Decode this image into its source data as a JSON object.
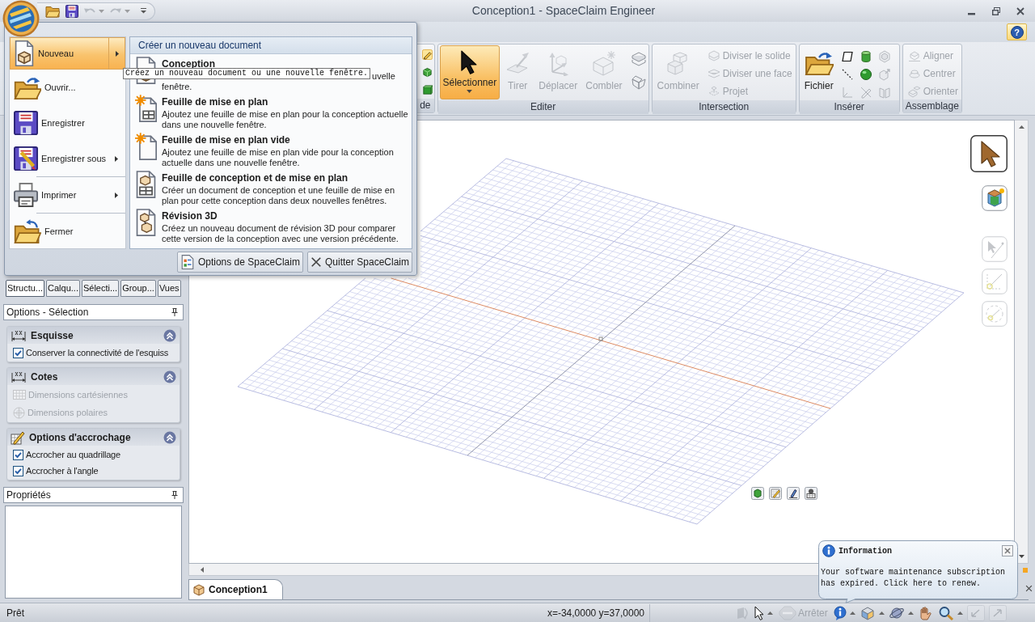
{
  "window": {
    "title": "Conception1 - SpaceClaim Engineer"
  },
  "quick_access": [
    {
      "disabled": false
    },
    {
      "disabled": false
    },
    {
      "disabled": true,
      "dropdown": true
    },
    {
      "disabled": true,
      "dropdown": true
    }
  ],
  "help_button": {
    "label": "?"
  },
  "ribbon": {
    "groups": [
      {
        "label": "de",
        "small_tools": [
          {
            "selected": true
          },
          {
            "selected": false
          },
          {
            "selected": false
          }
        ]
      },
      {
        "label": "Editer",
        "large_tools": [
          {
            "label": "Sélectionner",
            "selected": true,
            "dropdown": true,
            "disabled": false
          },
          {
            "label": "Tirer",
            "selected": false,
            "disabled": true
          },
          {
            "label": "Déplacer",
            "selected": false,
            "disabled": true
          },
          {
            "label": "Combler",
            "selected": false,
            "disabled": true
          }
        ],
        "small_tools": [
          {
            "disabled": false
          },
          {
            "disabled": false
          }
        ]
      },
      {
        "label": "Intersection",
        "large_tools": [
          {
            "label": "Combiner",
            "disabled": true
          }
        ],
        "small_tools": [
          {
            "label": "Diviser le solide",
            "disabled": true
          },
          {
            "label": "Diviser une face",
            "disabled": true
          },
          {
            "label": "Projet",
            "disabled": true
          }
        ]
      },
      {
        "label": "Insérer",
        "large_tools": [
          {
            "label": "Fichier",
            "disabled": false
          }
        ],
        "small_tools": [
          {
            "disabled": false
          },
          {
            "disabled": false
          },
          {
            "disabled": true
          },
          {
            "disabled": false
          },
          {
            "disabled": false
          },
          {
            "disabled": true
          },
          {
            "disabled": true
          },
          {
            "disabled": true
          },
          {
            "disabled": true
          }
        ]
      },
      {
        "label": "Assemblage",
        "small_tools": [
          {
            "label": "Aligner",
            "disabled": true
          },
          {
            "label": "Centrer",
            "disabled": true
          },
          {
            "label": "Orienter",
            "disabled": true
          }
        ]
      }
    ]
  },
  "app_menu": {
    "item_groups": [
      [
        {
          "label": "Nouveau",
          "selected": true,
          "submenu": true
        },
        {
          "label": "Ouvrir...",
          "selected": false,
          "submenu": false
        },
        {
          "label": "Enregistrer",
          "selected": false,
          "submenu": false
        },
        {
          "label": "Enregistrer sous",
          "selected": false,
          "submenu": true
        }
      ],
      [
        {
          "label": "Imprimer",
          "selected": false,
          "submenu": true
        }
      ],
      [
        {
          "label": "Fermer",
          "selected": false,
          "submenu": false
        }
      ]
    ],
    "submenu": {
      "title": "Créer un nouveau document",
      "items": [
        {
          "title": "Conception",
          "description_parts": [
            "uvelle",
            "fenêtre."
          ]
        },
        {
          "title": "Feuille de mise en plan",
          "description": "Ajoutez une feuille de mise en plan pour la conception actuelle dans une nouvelle fenêtre."
        },
        {
          "title": "Feuille de mise en plan vide",
          "description": "Ajoutez une feuille de mise en plan vide pour la conception actuelle dans une nouvelle fenêtre."
        },
        {
          "title": "Feuille de conception et de mise en plan",
          "description": "Créer un document de conception et une feuille de mise en plan pour cette conception dans deux nouvelles fenêtres."
        },
        {
          "title": "Révision 3D",
          "description": "Créez un nouveau document de révision 3D pour comparer cette version de la conception avec une version précédente."
        }
      ]
    },
    "tooltip": "Créez un nouveau document ou une nouvelle fenêtre.",
    "buttons": [
      {
        "label": "Options de SpaceClaim"
      },
      {
        "label": "Quitter SpaceClaim"
      }
    ]
  },
  "panel_tabs": [
    {
      "label": "Structu...",
      "selected": true
    },
    {
      "label": "Calqu...",
      "selected": false
    },
    {
      "label": "Sélecti...",
      "selected": false
    },
    {
      "label": "Group...",
      "selected": false
    },
    {
      "label": "Vues",
      "selected": false
    }
  ],
  "options_panel": {
    "title": "Options - Sélection",
    "sections": [
      {
        "title": "Esquisse",
        "expanded": true,
        "items": [
          {
            "kind": "checkbox",
            "label": "Conserver la connectivité de l'esquiss",
            "checked": true
          }
        ]
      },
      {
        "title": "Cotes",
        "expanded": true,
        "items": [
          {
            "kind": "option",
            "label": "Dimensions cartésiennes",
            "disabled": true
          },
          {
            "kind": "option",
            "label": "Dimensions polaires",
            "disabled": true
          }
        ]
      },
      {
        "title": "Options d'accrochage",
        "expanded": true,
        "items": [
          {
            "kind": "checkbox",
            "label": "Accrocher au quadrillage",
            "checked": true
          },
          {
            "kind": "checkbox",
            "label": "Accrocher à l'angle",
            "checked": true
          }
        ]
      }
    ]
  },
  "properties_panel": {
    "title": "Propriétés"
  },
  "viewport": {
    "tools": [
      {
        "selected": true,
        "disabled": false
      },
      {
        "selected": false,
        "disabled": false
      },
      {
        "selected": false,
        "disabled": true
      },
      {
        "selected": false,
        "disabled": true
      },
      {
        "selected": false,
        "disabled": true
      }
    ]
  },
  "document_tabs": [
    {
      "label": "Conception1",
      "selected": true
    }
  ],
  "status_bar": {
    "status": "Prêt",
    "coordinates": "x=-34,0000 y=37,0000",
    "tools": [
      {
        "disabled": true
      },
      {
        "disabled": false,
        "dropdown": true
      },
      {
        "label": "Arrêter",
        "disabled": true
      },
      {
        "disabled": false,
        "dropdown": true
      },
      {
        "disabled": false,
        "dropdown": true
      },
      {
        "disabled": false,
        "dropdown": true
      },
      {
        "disabled": false
      },
      {
        "disabled": false,
        "dropdown": true
      },
      {
        "disabled": true
      },
      {
        "disabled": true
      }
    ]
  },
  "notification": {
    "title": "Information",
    "message": "Your software maintenance subscription has expired. Click here to renew."
  }
}
